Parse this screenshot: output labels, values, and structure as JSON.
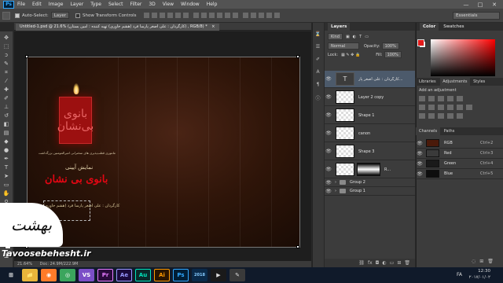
{
  "app": {
    "logo": "Ps"
  },
  "menubar": {
    "items": [
      "File",
      "Edit",
      "Image",
      "Layer",
      "Type",
      "Select",
      "Filter",
      "3D",
      "View",
      "Window",
      "Help"
    ]
  },
  "window_controls": {
    "minimize": "—",
    "maximize": "□",
    "close": "✕"
  },
  "options_bar": {
    "auto_select_label": "Auto-Select:",
    "auto_select_value": "Layer",
    "transform_label": "Show Transform Controls",
    "auto_select_checked": true,
    "transform_checked": false
  },
  "workspace_switcher": "Essentials",
  "document": {
    "tab_title": "Untitled-1.psd @ 21.6% (کارگردان : علی اصغر پارسا فرد (هشم خاوری) تهیه کننده : امین بستان) , RGB/8) *",
    "close": "×",
    "zoom": "21.64%",
    "doc_size": "Doc: 24.9M/222.9M"
  },
  "poster": {
    "candle_emblem": "بانوی بی‌نشان",
    "tagline": "مانتوری قطب‌پذیری های سخنرانی امیرالمومنین بزرگداشت",
    "show_label": "نمایش آیینی",
    "title": "بانوی بی نشان",
    "director": "کارگردان : علی اصغر پارسا فرد (هشم خاوری)"
  },
  "watermark": {
    "logo": "بهشت",
    "text": "Tavoosebehesht.ir"
  },
  "layers_panel": {
    "tabs": [
      "Layers"
    ],
    "filter": "Kind",
    "blend_mode": "Normal",
    "opacity_label": "Opacity:",
    "opacity": "100%",
    "lock_label": "Lock:",
    "fill_label": "Fill:",
    "fill": "100%",
    "layers": [
      {
        "name": "کارگردان : علی اصغر پار...",
        "thumb": "T",
        "visible": true,
        "active": true
      },
      {
        "name": "Layer 2 copy",
        "thumb": "",
        "visible": true,
        "active": false
      },
      {
        "name": "Shape 1",
        "thumb": "",
        "visible": true,
        "active": false
      },
      {
        "name": "canon",
        "thumb": "",
        "visible": true,
        "active": false
      },
      {
        "name": "Shape 3",
        "thumb": "",
        "visible": true,
        "active": false
      },
      {
        "name": "R...",
        "thumb": "",
        "visible": true,
        "active": false
      }
    ],
    "groups": [
      "Group 2",
      "Group 1"
    ],
    "footer_icons": [
      "link-icon",
      "fx-icon",
      "mask-icon",
      "adjustment-icon",
      "folder-icon",
      "new-layer-icon",
      "trash-icon"
    ]
  },
  "color_panel": {
    "tabs": [
      "Color",
      "Swatches"
    ],
    "foreground": "#e51b1b",
    "background": "#ffffff"
  },
  "adjustments_panel": {
    "tabs": [
      "Libraries",
      "Adjustments",
      "Styles"
    ],
    "heading": "Add an adjustment"
  },
  "channels_panel": {
    "tabs": [
      "Channels",
      "Paths"
    ],
    "channels": [
      {
        "name": "RGB",
        "shortcut": "Ctrl+2"
      },
      {
        "name": "Red",
        "shortcut": "Ctrl+3"
      },
      {
        "name": "Green",
        "shortcut": "Ctrl+4"
      },
      {
        "name": "Blue",
        "shortcut": "Ctrl+5"
      }
    ]
  },
  "taskbar": {
    "apps": [
      {
        "name": "windows-explorer",
        "label": "📁",
        "color": "#e7b53b"
      },
      {
        "name": "firefox",
        "label": "◉",
        "color": "#ff7b29"
      },
      {
        "name": "chrome",
        "label": "◎",
        "color": "#3ba55d"
      },
      {
        "name": "visual-studio",
        "label": "VS",
        "color": "#7b4fc7"
      },
      {
        "name": "premiere",
        "label": "Pr",
        "color": "#2a0a3c"
      },
      {
        "name": "after-effects",
        "label": "Ae",
        "color": "#1a0a3c"
      },
      {
        "name": "audition",
        "label": "Au",
        "color": "#0a2a2a"
      },
      {
        "name": "illustrator",
        "label": "Ai",
        "color": "#2a1400"
      },
      {
        "name": "photoshop",
        "label": "Ps",
        "color": "#001e36"
      },
      {
        "name": "app-2018",
        "label": "2018",
        "color": "#0a2a4a"
      },
      {
        "name": "media",
        "label": "▶",
        "color": "#1a1a1a"
      },
      {
        "name": "paint",
        "label": "✎",
        "color": "#3a3a3a"
      }
    ],
    "lang": "FA",
    "time": "12:30",
    "date": "۲۰۱۷/۰۱/۰۲"
  }
}
